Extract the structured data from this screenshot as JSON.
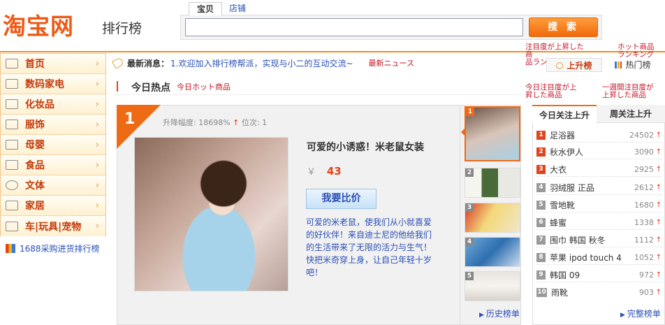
{
  "header": {
    "logo": "淘宝网",
    "logo_sub": "排行榜",
    "search_tabs": [
      "宝贝",
      "店铺"
    ],
    "search_value": "",
    "search_button": "搜 索"
  },
  "sidebar": {
    "items": [
      {
        "label": "首页",
        "icon": "home-icon"
      },
      {
        "label": "数码家电",
        "icon": "laptop-icon"
      },
      {
        "label": "化妆品",
        "icon": "cosmetics-icon"
      },
      {
        "label": "服饰",
        "icon": "shirt-icon"
      },
      {
        "label": "母婴",
        "icon": "baby-bottle-icon"
      },
      {
        "label": "食品",
        "icon": "food-icon"
      },
      {
        "label": "文体",
        "icon": "ball-icon"
      },
      {
        "label": "家居",
        "icon": "sofa-icon"
      },
      {
        "label": "车|玩具|宠物",
        "icon": "car-icon"
      }
    ],
    "arrow": "›",
    "link_1688": "1688采购进货排行榜"
  },
  "news": {
    "label": "最新消息：",
    "text": "1.欢迎加入排行榜帮派，实现与小二的互动交流~",
    "jp": "最新ニュース"
  },
  "rank_toggle": {
    "up_label": "上升榜",
    "hot_label": "热门榜"
  },
  "annotations": {
    "up_jp": "注目度が上昇した商\n品ランキング",
    "hot_jp": "ホット商品\nランキング",
    "today_jp": "今日注目度が上\n昇した商品",
    "week_jp": "一週間注目度が\n上昇した商品"
  },
  "hot": {
    "title": "今日热点",
    "jp": "今日ホット商品"
  },
  "feature": {
    "rank": "1",
    "meta_label": "升降幅度: 18698%",
    "meta_up": "↑",
    "meta_pos": " 位次: 1",
    "title": "可爱的小诱惑！米老鼠女装",
    "currency": "￥",
    "price": "43",
    "compare_button": "我要比价",
    "description": "可爱的米老鼠，使我们从小就喜爱的好伙伴！来自迪士尼的他给我们的生活带来了无限的活力与生气！快把米奇穿上身，让自己年轻十岁吧！"
  },
  "thumbs": [
    "1",
    "2",
    "3",
    "4",
    "5"
  ],
  "history_link": "历史榜单",
  "ranking": {
    "tab_today": "今日关注上升",
    "tab_week": "周关注上升",
    "rows": [
      {
        "num": "1",
        "name": "足浴器",
        "value": "24502"
      },
      {
        "num": "2",
        "name": "秋水伊人",
        "value": "3090"
      },
      {
        "num": "3",
        "name": "大衣",
        "value": "2925"
      },
      {
        "num": "4",
        "name": "羽绒服 正品",
        "value": "2612"
      },
      {
        "num": "5",
        "name": "雪地靴",
        "value": "1680"
      },
      {
        "num": "6",
        "name": "蜂蜜",
        "value": "1338"
      },
      {
        "num": "7",
        "name": "围巾 韩国 秋冬",
        "value": "1112"
      },
      {
        "num": "8",
        "name": "苹果 ipod touch 4",
        "value": "1052"
      },
      {
        "num": "9",
        "name": "韩国 09",
        "value": "972"
      },
      {
        "num": "10",
        "name": "雨靴",
        "value": "903"
      }
    ],
    "up_arrow": "↑",
    "full_link": "完整榜单"
  },
  "colors": {
    "brand_orange": "#ee5a16",
    "link_blue": "#2b4fb5",
    "annotation_red": "#c2142a"
  }
}
